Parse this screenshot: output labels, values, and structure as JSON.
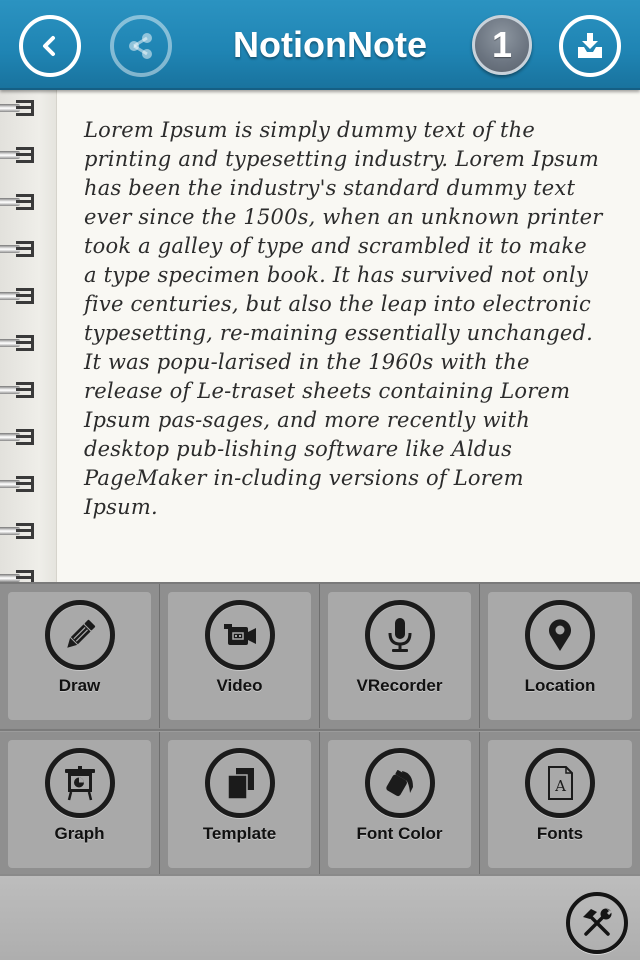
{
  "header": {
    "title": "NotionNote",
    "badge_count": "1",
    "back_icon": "chevron-left-icon",
    "share_icon": "share-icon",
    "download_icon": "download-tray-icon",
    "accent_color": "#1f84b3"
  },
  "note": {
    "body": "Lorem Ipsum is simply dummy text of the printing and typesetting industry. Lorem Ipsum has been the industry's standard dummy text ever since the 1500s, when an unknown printer took a galley of type and scrambled it to make a type specimen book. It has survived not only five centuries, but also the leap into electronic typesetting, re-maining essentially unchanged. It was popu-larised in the 1960s with the release of Le-traset sheets containing Lorem Ipsum pas-sages, and more recently with desktop pub-lishing software like Aldus PageMaker in-cluding versions of Lorem Ipsum."
  },
  "tools": [
    {
      "label": "Draw",
      "icon": "pencil-icon"
    },
    {
      "label": "Video",
      "icon": "video-camera-icon"
    },
    {
      "label": "VRecorder",
      "icon": "microphone-icon"
    },
    {
      "label": "Location",
      "icon": "location-pin-icon"
    },
    {
      "label": "Graph",
      "icon": "presentation-chart-icon"
    },
    {
      "label": "Template",
      "icon": "copy-pages-icon"
    },
    {
      "label": "Font Color",
      "icon": "paint-bucket-icon"
    },
    {
      "label": "Fonts",
      "icon": "font-document-icon"
    }
  ],
  "bottom": {
    "settings_icon": "hammer-wrench-icon"
  }
}
